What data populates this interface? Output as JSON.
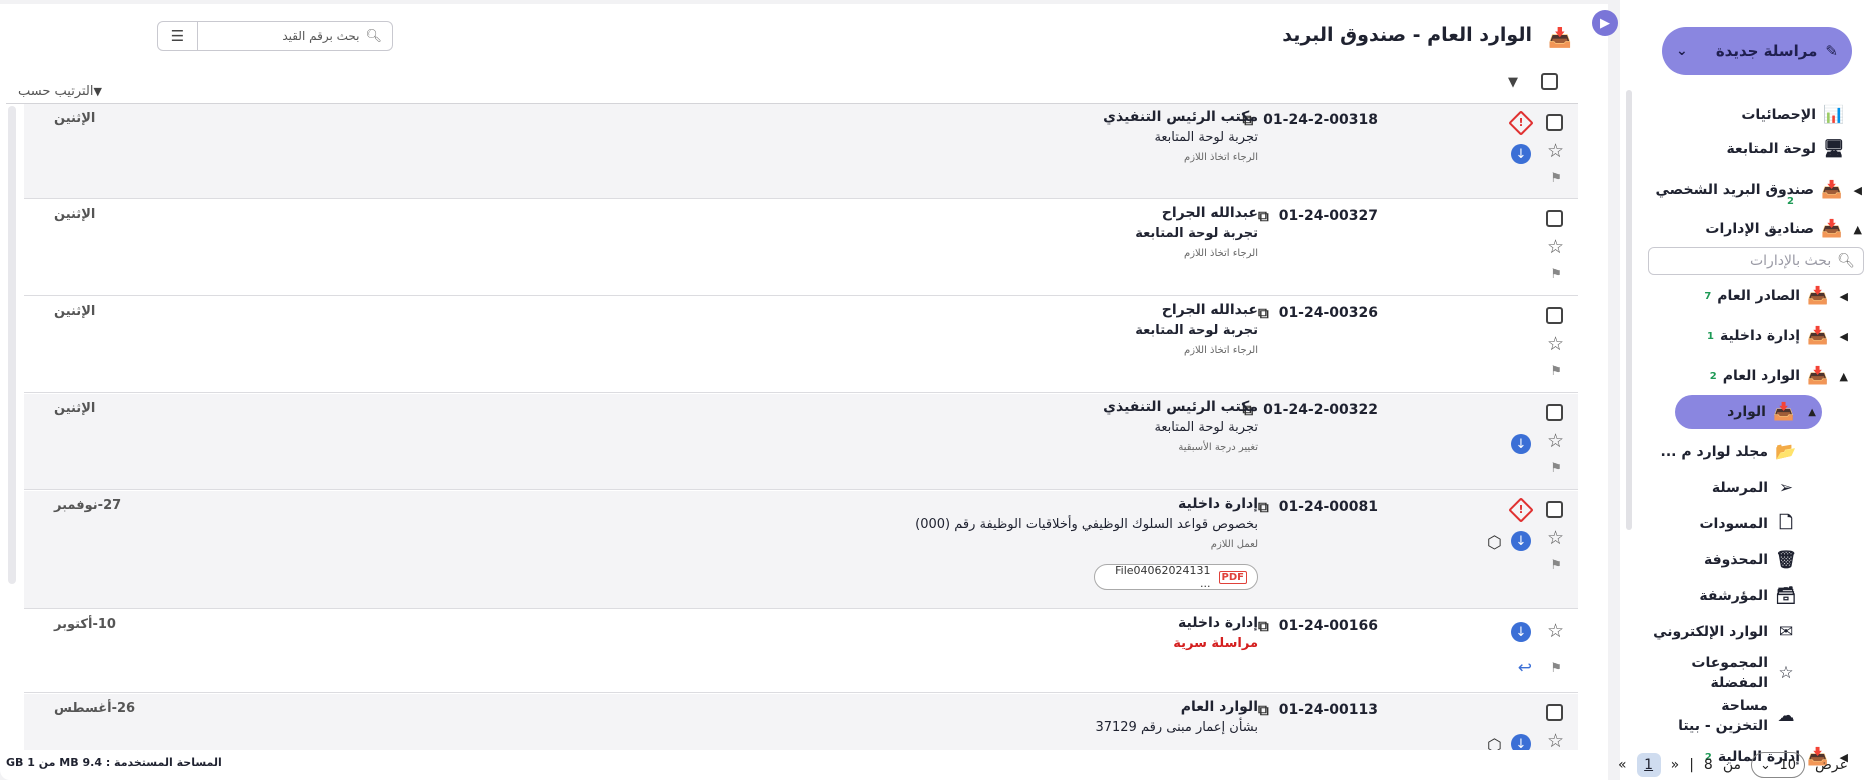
{
  "sidebar": {
    "new_message": "مراسلة جديدة",
    "dept_search_placeholder": "بحث بالإدارات",
    "items": [
      {
        "label": "الإحصائيات",
        "icon": "chart-icon"
      },
      {
        "label": "لوحة المتابعة",
        "icon": "monitor-icon"
      },
      {
        "label": "صندوق البريد الشخصي",
        "badge": "2",
        "icon": "inbox-icon"
      },
      {
        "label": "صناديق الإدارات",
        "icon": "inbox-icon"
      },
      {
        "label": "الصادر العام",
        "badge": "7",
        "icon": "inbox-icon"
      },
      {
        "label": "إدارة داخلية",
        "badge": "1",
        "icon": "inbox-icon"
      },
      {
        "label": "الوارد العام",
        "badge": "2",
        "icon": "inbox-icon"
      },
      {
        "label": "الوارد",
        "icon": "inbox-icon"
      },
      {
        "label": "مجلد لوارد م ...",
        "icon": "folder-icon"
      },
      {
        "label": "المرسلة",
        "icon": "send-icon"
      },
      {
        "label": "المسودات",
        "icon": "document-icon"
      },
      {
        "label": "المحذوفة",
        "icon": "trash-icon"
      },
      {
        "label": "المؤرشفة",
        "icon": "archive-icon"
      },
      {
        "label": "الوارد الإلكتروني",
        "icon": "envelope-icon"
      },
      {
        "label": "المجموعات المفضلة",
        "icon": "star-icon"
      },
      {
        "label": "مساحة التخزين - بيتا",
        "icon": "cloud-icon"
      },
      {
        "label": "إدارة المالية",
        "badge": "2",
        "icon": "inbox-icon"
      }
    ]
  },
  "main": {
    "title": "الوارد العام - صندوق البريد",
    "search_placeholder": "بحث برقم القيد",
    "sort_label": "الترتيب حسب"
  },
  "messages": [
    {
      "ref": "01-24-2-00318",
      "sender": "مكتب الرئيس التنفيذي",
      "subject": "تجربة لوحة المتابعة",
      "note": "الرجاء اتخاذ اللازم",
      "date": "الإثنين"
    },
    {
      "ref": "01-24-00327",
      "sender": "عبدالله الجراح",
      "subject": "تجربة لوحة المتابعة",
      "note": "الرجاء اتخاذ اللازم",
      "date": "الإثنين"
    },
    {
      "ref": "01-24-00326",
      "sender": "عبدالله الجراح",
      "subject": "تجربة لوحة المتابعة",
      "note": "الرجاء اتخاذ اللازم",
      "date": "الإثنين"
    },
    {
      "ref": "01-24-2-00322",
      "sender": "مكتب الرئيس التنفيذي",
      "subject": "تجربة لوحة المتابعة",
      "note": "تغيير درجة الأسبقية",
      "date": "الإثنين"
    },
    {
      "ref": "01-24-00081",
      "sender": "إدارة داخلية",
      "subject": "بخصوص قواعد السلوك الوظيفي وأخلاقيات الوظيفة رقم (000)",
      "note": "لعمل اللازم",
      "date": "27-نوفمبر",
      "attachment": "File04062024131 ..."
    },
    {
      "ref": "01-24-00166",
      "sender": "إدارة داخلية",
      "subject": "مراسلة سرية",
      "note": "",
      "date": "10-أكتوبر"
    },
    {
      "ref": "01-24-00113",
      "sender": "الوارد العام",
      "subject": "بشأن إعمار مبنى رقم 37129",
      "note": "",
      "date": "26-أغسطس"
    }
  ],
  "footer": {
    "show": "عرض",
    "per_page": "10",
    "of": "من",
    "total_pages": "8",
    "separator": "|",
    "current_page": "1",
    "prev": "«",
    "next": "»",
    "storage": "المساحة المستخدمة : 9.4 MB من 1 GB"
  },
  "colors": {
    "accent": "#8a86e0",
    "urgent": "#e03131",
    "link_blue": "#3b6fd6",
    "confidential": "#d41f1f",
    "badge_green": "#1e9a56"
  }
}
